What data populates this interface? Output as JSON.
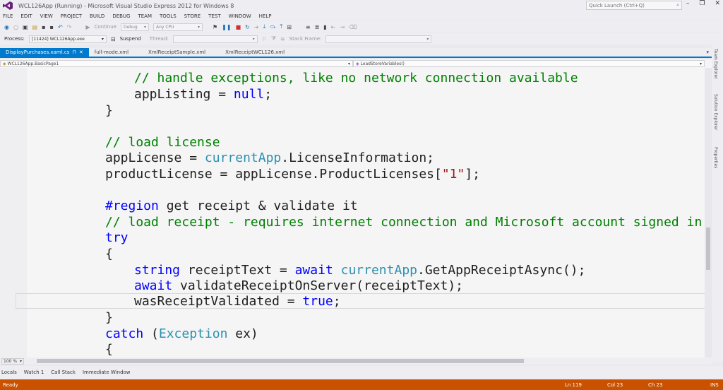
{
  "window": {
    "title": "WCL126App (Running) - Microsoft Visual Studio Express 2012 for Windows 8",
    "quick_launch_placeholder": "Quick Launch (Ctrl+Q)",
    "min": "–",
    "restore": "❐",
    "close": "✕"
  },
  "menu": [
    "FILE",
    "EDIT",
    "VIEW",
    "PROJECT",
    "BUILD",
    "DEBUG",
    "TEAM",
    "TOOLS",
    "STORE",
    "TEST",
    "WINDOW",
    "HELP"
  ],
  "toolbar": {
    "continue_label": "Continue",
    "config": "Debug",
    "platform": "Any CPU",
    "process_label": "Process:",
    "process_value": "[11424] WCL126App.exe",
    "suspend_label": "Suspend",
    "thread_label": "Thread:",
    "stack_frame_label": "Stack Frame:"
  },
  "tabs": [
    {
      "label": "DisplayPurchases.xaml.cs",
      "active": true
    },
    {
      "label": "full-mode.xml",
      "active": false
    },
    {
      "label": "XmlReceiptSample.xml",
      "active": false
    },
    {
      "label": "XmlReceiptWCL126.xml",
      "active": false
    }
  ],
  "nav": {
    "type_combo": "WCL126App.BasicPage1",
    "member_combo": "LoadStoreVariables()"
  },
  "code": {
    "l1_comment": "// handle exceptions, like no network connection available",
    "l2_a": "appListing = ",
    "l2_kw": "null",
    "l2_b": ";",
    "l3": "}",
    "l4_comment": "// load license",
    "l5_a": "appLicense = ",
    "l5_ty": "currentApp",
    "l5_b": ".LicenseInformation;",
    "l6_a": "productLicense = appLicense.ProductLicenses[",
    "l6_str": "\"1\"",
    "l6_b": "];",
    "l7_region": "#region",
    "l7_b": " get receipt & validate it",
    "l8_comment": "// load receipt - requires internet connection and Microsoft account signed in to S",
    "l9_kw": "try",
    "l10": "{",
    "l11_kw1": "string",
    "l11_a": " receiptText = ",
    "l11_kw2": "await",
    "l11_b": " ",
    "l11_ty": "currentApp",
    "l11_c": ".GetAppReceiptAsync();",
    "l12_kw": "await",
    "l12_b": " validateReceiptOnServer(receiptText);",
    "l13_a": "wasReceiptValidated = ",
    "l13_kw": "true",
    "l13_b": ";",
    "l14": "}",
    "l15_kw": "catch",
    "l15_a": " (",
    "l15_ty": "Exception",
    "l15_b": " ex)",
    "l16": "{"
  },
  "side_tabs": [
    "Team Explorer",
    "Solution Explorer",
    "Properties"
  ],
  "zoom": "100 %",
  "bottom_tabs": [
    "Locals",
    "Watch 1",
    "Call Stack",
    "Immediate Window"
  ],
  "status": {
    "state": "Ready",
    "ln": "Ln 119",
    "col": "Col 23",
    "ch": "Ch 23",
    "ins": "INS"
  },
  "colors": {
    "accent": "#007acc",
    "status_debug": "#ca5100",
    "keyword": "#0000ff",
    "type": "#2b91af",
    "comment": "#008000",
    "string": "#a31515"
  }
}
